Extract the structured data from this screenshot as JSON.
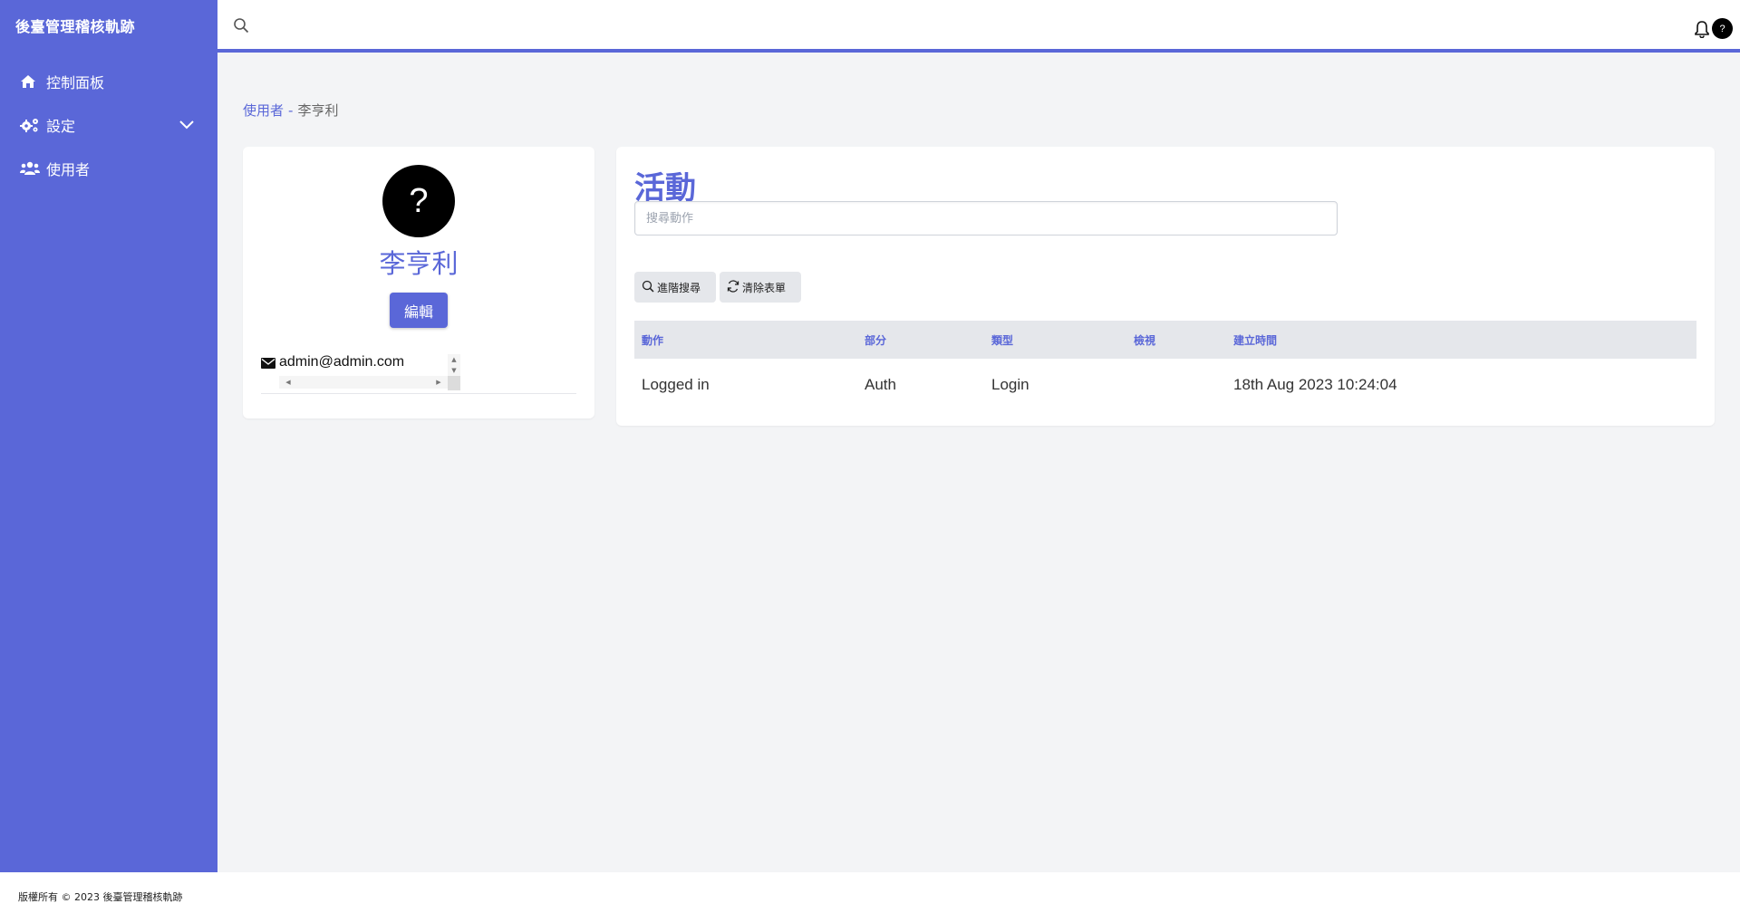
{
  "app": {
    "brand": "後臺管理稽核軌跡"
  },
  "sidebar": {
    "items": [
      {
        "label": "控制面板",
        "icon": "home-icon"
      },
      {
        "label": "設定",
        "icon": "cogs-icon",
        "expandable": true
      },
      {
        "label": "使用者",
        "icon": "users-icon"
      }
    ]
  },
  "topbar": {
    "avatar_text": "?"
  },
  "breadcrumb": {
    "parent": "使用者",
    "separator": "-",
    "current": "李亨利"
  },
  "profile": {
    "avatar_text": "?",
    "name": "李亨利",
    "edit_label": "編輯",
    "email": "admin@admin.com"
  },
  "activity": {
    "title": "活動",
    "search_placeholder": "搜尋動作",
    "advanced_search_label": "進階搜尋",
    "clear_form_label": "清除表單",
    "columns": [
      "動作",
      "部分",
      "類型",
      "檢視",
      "建立時間"
    ],
    "rows": [
      {
        "action": "Logged in",
        "section": "Auth",
        "type": "Login",
        "view": "",
        "created": "18th Aug 2023 10:24:04"
      }
    ]
  },
  "footer": {
    "text": "版權所有 © 2023 後臺管理稽核軌跡"
  },
  "colors": {
    "primary": "#5a67d8",
    "background": "#f3f4f6",
    "surface": "#ffffff"
  }
}
